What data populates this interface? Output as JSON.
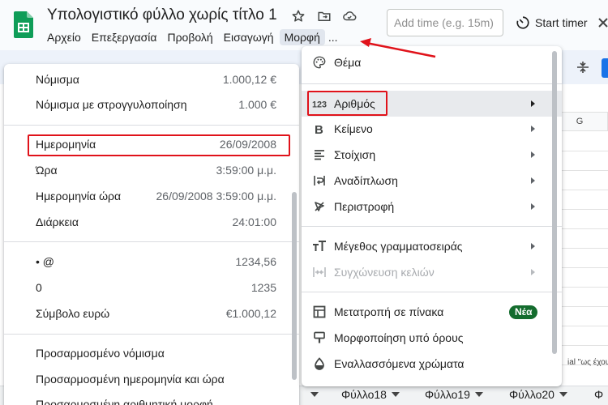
{
  "app": {
    "document_title": "Υπολογιστικό φύλλο χωρίς τίτλο 1",
    "menu_items": [
      "Αρχείο",
      "Επεξεργασία",
      "Προβολή",
      "Εισαγωγή",
      "Μορφή",
      "..."
    ],
    "active_menu": "Μορφή",
    "timer_input_placeholder": "Add time (e.g. 15m)",
    "start_timer_label": "Start timer"
  },
  "grid": {
    "column_header": "G",
    "cell_snippet": "ial \"ως έχου"
  },
  "sheet_tabs": [
    "Φύλλο18",
    "Φύλλο19",
    "Φύλλο20"
  ],
  "number_submenu": {
    "groups": [
      [
        {
          "label": "Νόμισμα",
          "value": "1.000,12 €"
        },
        {
          "label": "Νόμισμα με στρογγυλοποίηση",
          "value": "1.000 €"
        }
      ],
      [
        {
          "label": "Ημερομηνία",
          "value": "26/09/2008"
        },
        {
          "label": "Ώρα",
          "value": "3:59:00 μ.μ."
        },
        {
          "label": "Ημερομηνία ώρα",
          "value": "26/09/2008 3:59:00 μ.μ."
        },
        {
          "label": "Διάρκεια",
          "value": "24:01:00"
        }
      ],
      [
        {
          "label": "• @",
          "value": "1234,56"
        },
        {
          "label": "0",
          "value": "1235"
        },
        {
          "label": "Σύμβολο ευρώ",
          "value": "€1.000,12"
        }
      ],
      [
        {
          "label": "Προσαρμοσμένο νόμισμα",
          "value": ""
        },
        {
          "label": "Προσαρμοσμένη ημερομηνία και ώρα",
          "value": ""
        },
        {
          "label": "Προσαρμοσμένη αριθμητική μορφή",
          "value": ""
        }
      ]
    ]
  },
  "format_menu": {
    "items": [
      {
        "label": "Θέμα",
        "icon": "palette-icon",
        "submenu": false
      },
      {
        "label": "Αριθμός",
        "icon": "number-123-icon",
        "submenu": true,
        "highlighted": true
      },
      {
        "label": "Κείμενο",
        "icon": "bold-icon",
        "submenu": true
      },
      {
        "label": "Στοίχιση",
        "icon": "align-left-icon",
        "submenu": true
      },
      {
        "label": "Αναδίπλωση",
        "icon": "text-wrap-icon",
        "submenu": true
      },
      {
        "label": "Περιστροφή",
        "icon": "rotate-text-icon",
        "submenu": true
      },
      {
        "label": "Μέγεθος γραμματοσειράς",
        "icon": "font-size-icon",
        "submenu": true
      },
      {
        "label": "Συγχώνευση κελιών",
        "icon": "merge-cells-icon",
        "submenu": true,
        "disabled": true
      },
      {
        "label": "Μετατροπή σε πίνακα",
        "icon": "table-icon",
        "badge": "Νέα"
      },
      {
        "label": "Μορφοποίηση υπό όρους",
        "icon": "conditional-format-icon"
      },
      {
        "label": "Εναλλασσόμενα χρώματα",
        "icon": "fill-drop-icon"
      }
    ]
  },
  "colors": {
    "highlight_red": "#e0121a",
    "sheets_green": "#0f9d58",
    "badge_green": "#146c2e"
  }
}
